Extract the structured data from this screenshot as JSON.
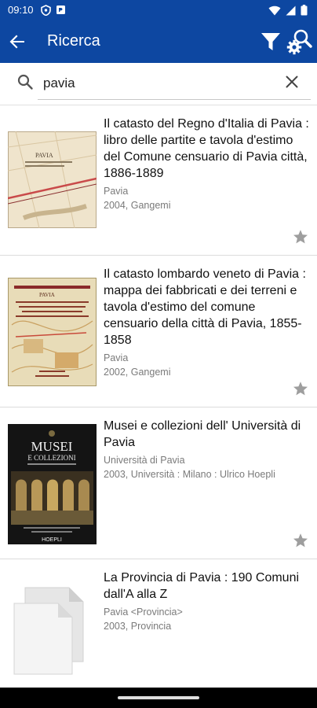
{
  "status": {
    "time": "09:10"
  },
  "appbar": {
    "title": "Ricerca"
  },
  "search": {
    "value": "pavia"
  },
  "results": [
    {
      "title": "Il catasto del Regno d'Italia di Pavia : libro delle partite e tavola d'estimo del Comune censuario di Pavia città, 1886-1889",
      "place": "Pavia",
      "publication": "2004, Gangemi",
      "cover_title": "PAVIA"
    },
    {
      "title": "Il catasto lombardo veneto di Pavia : mappa dei fabbricati e dei terreni e tavola d'estimo del comune censuario della città di Pavia, 1855-1858",
      "place": "Pavia",
      "publication": "2002, Gangemi",
      "cover_title": "PAVIA"
    },
    {
      "title": "Musei e collezioni dell' Università di Pavia",
      "place": "Università  di Pavia",
      "publication": "2003, Università : Milano : Ulrico Hoepli",
      "cover_title_1": "MUSEI",
      "cover_title_2": "E COLLEZIONI",
      "cover_publisher": "HOEPLI"
    },
    {
      "title": "La Provincia di Pavia : 190 Comuni dall'A alla Z",
      "place": "Pavia <Provincia>",
      "publication": "2003, Provincia"
    }
  ]
}
